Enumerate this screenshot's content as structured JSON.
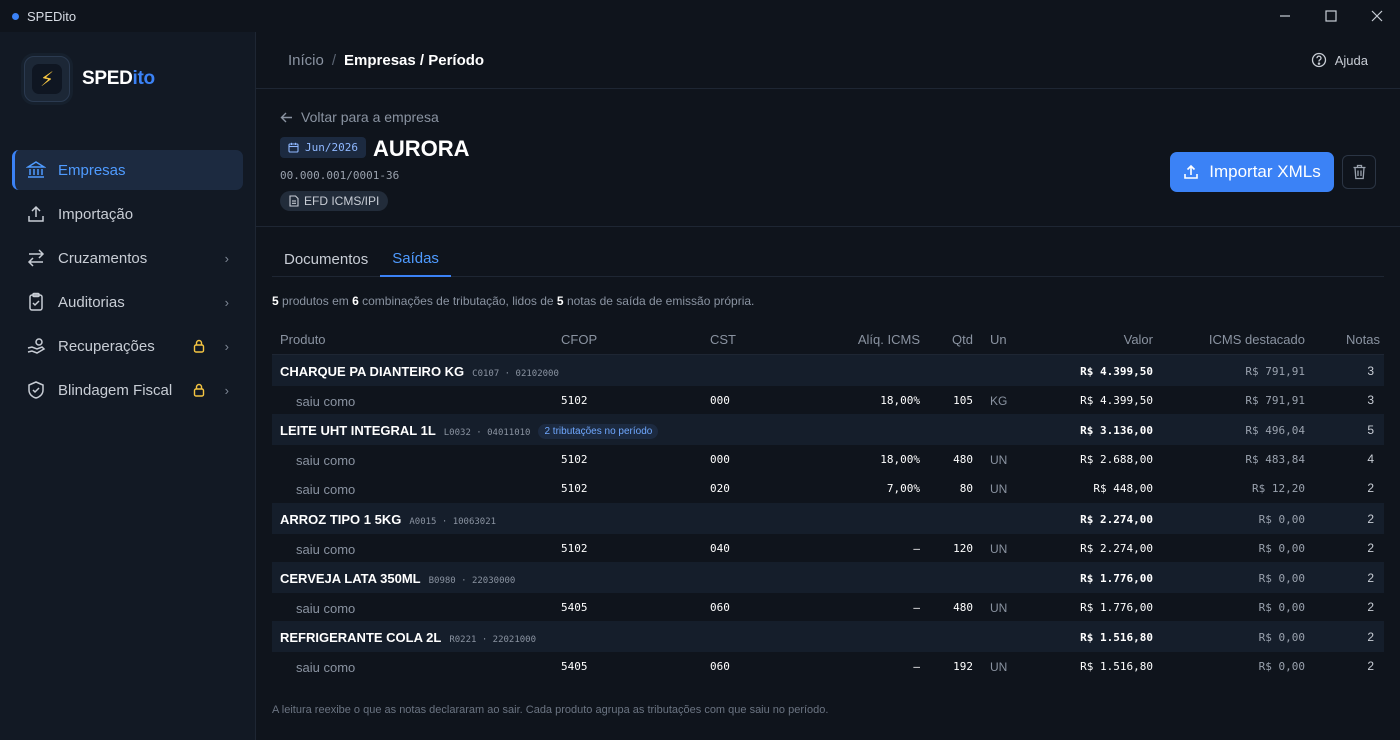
{
  "app": {
    "title": "SPEDito",
    "logo_a": "SPED",
    "logo_b": "ito"
  },
  "sidebar": {
    "items": [
      {
        "label": "Empresas"
      },
      {
        "label": "Importação"
      },
      {
        "label": "Cruzamentos"
      },
      {
        "label": "Auditorias"
      },
      {
        "label": "Recuperações"
      },
      {
        "label": "Blindagem Fiscal"
      }
    ]
  },
  "header": {
    "breadcrumb_home": "Início",
    "breadcrumb_sep": "/",
    "breadcrumb_current": "Empresas / Período",
    "help": "Ajuda"
  },
  "company": {
    "back": "Voltar para a empresa",
    "period": "Jun/2026",
    "name": "AURORA",
    "cnpj": "00.000.001/0001-36",
    "chip": "EFD ICMS/IPI",
    "import_button": "Importar XMLs"
  },
  "tabs": [
    {
      "label": "Documentos"
    },
    {
      "label": "Saídas"
    }
  ],
  "summary": {
    "n_products": "5",
    "t1": "produtos em",
    "n_combos": "6",
    "t2": "combinações de tributação, lidos de",
    "n_notes": "5",
    "t3": "notas de saída de emissão própria."
  },
  "table": {
    "columns": {
      "produto": "Produto",
      "cfop": "CFOP",
      "cst": "CST",
      "aliq": "Alíq. ICMS",
      "qtd": "Qtd",
      "un": "Un",
      "valor": "Valor",
      "icms": "ICMS destacado",
      "notas": "Notas"
    },
    "saiu_label": "saiu como",
    "groups": [
      {
        "name": "CHARQUE PA DIANTEIRO KG",
        "code": "C0107 · 02102000",
        "tag": "",
        "valor": "R$ 4.399,50",
        "icms": "R$ 791,91",
        "notas": "3",
        "rows": [
          {
            "cfop": "5102",
            "cst": "000",
            "aliq": "18,00%",
            "qtd": "105",
            "un": "KG",
            "valor": "R$ 4.399,50",
            "icms": "R$ 791,91",
            "notas": "3"
          }
        ]
      },
      {
        "name": "LEITE UHT INTEGRAL 1L",
        "code": "L0032 · 04011010",
        "tag": "2 tributações no período",
        "valor": "R$ 3.136,00",
        "icms": "R$ 496,04",
        "notas": "5",
        "rows": [
          {
            "cfop": "5102",
            "cst": "000",
            "aliq": "18,00%",
            "qtd": "480",
            "un": "UN",
            "valor": "R$ 2.688,00",
            "icms": "R$ 483,84",
            "notas": "4"
          },
          {
            "cfop": "5102",
            "cst": "020",
            "aliq": "7,00%",
            "qtd": "80",
            "un": "UN",
            "valor": "R$ 448,00",
            "icms": "R$ 12,20",
            "notas": "2"
          }
        ]
      },
      {
        "name": "ARROZ TIPO 1 5KG",
        "code": "A0015 · 10063021",
        "tag": "",
        "valor": "R$ 2.274,00",
        "icms": "R$ 0,00",
        "notas": "2",
        "rows": [
          {
            "cfop": "5102",
            "cst": "040",
            "aliq": "—",
            "qtd": "120",
            "un": "UN",
            "valor": "R$ 2.274,00",
            "icms": "R$ 0,00",
            "notas": "2"
          }
        ]
      },
      {
        "name": "CERVEJA LATA 350ML",
        "code": "B0980 · 22030000",
        "tag": "",
        "valor": "R$ 1.776,00",
        "icms": "R$ 0,00",
        "notas": "2",
        "rows": [
          {
            "cfop": "5405",
            "cst": "060",
            "aliq": "—",
            "qtd": "480",
            "un": "UN",
            "valor": "R$ 1.776,00",
            "icms": "R$ 0,00",
            "notas": "2"
          }
        ]
      },
      {
        "name": "REFRIGERANTE COLA 2L",
        "code": "R0221 · 22021000",
        "tag": "",
        "valor": "R$ 1.516,80",
        "icms": "R$ 0,00",
        "notas": "2",
        "rows": [
          {
            "cfop": "5405",
            "cst": "060",
            "aliq": "—",
            "qtd": "192",
            "un": "UN",
            "valor": "R$ 1.516,80",
            "icms": "R$ 0,00",
            "notas": "2"
          }
        ]
      }
    ]
  },
  "footnote": "A leitura reexibe o que as notas declararam ao sair. Cada produto agrupa as tributações com que saiu no período.",
  "colors": {
    "accent": "#3b82f6",
    "background": "#0f141c",
    "sidebar": "#121924"
  }
}
